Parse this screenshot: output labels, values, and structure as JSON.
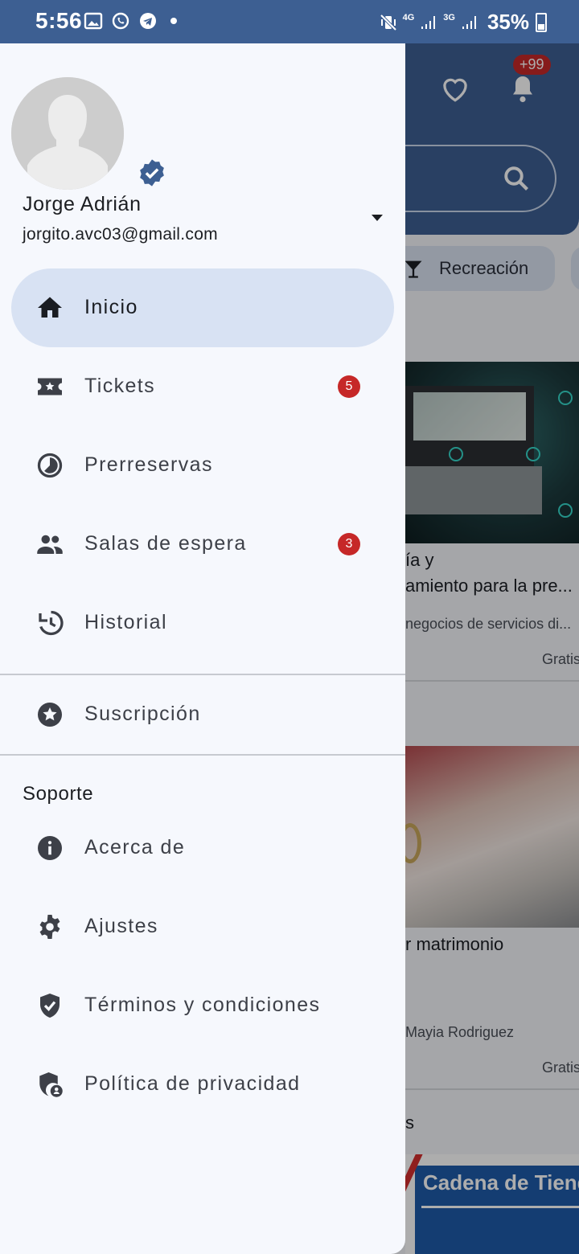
{
  "status_bar": {
    "time": "5:56",
    "net1": "4G",
    "net2": "3G",
    "battery": "35%"
  },
  "background": {
    "notifications_badge": "+99",
    "chip_label": "Recreación",
    "card1_title_line1": "ía y",
    "card1_title_line2": "amiento para la pre...",
    "card1_sub": "negocios de servicios di...",
    "card1_price": "Gratis",
    "card2_title": "r matrimonio",
    "card2_sub": "Mayia Rodriguez",
    "card2_price": "Gratis",
    "card3_header": "s",
    "card3_banner": "Cadena de Tiendas"
  },
  "drawer": {
    "user": {
      "name": "Jorge Adrián",
      "email": "jorgito.avc03@gmail.com"
    },
    "main_items": [
      {
        "label": "Inicio",
        "icon": "home-icon",
        "active": true
      },
      {
        "label": "Tickets",
        "icon": "ticket-icon",
        "badge": "5"
      },
      {
        "label": "Prerreservas",
        "icon": "pie-clock-icon"
      },
      {
        "label": "Salas de espera",
        "icon": "people-icon",
        "badge": "3"
      },
      {
        "label": "Historial",
        "icon": "history-icon"
      }
    ],
    "subscription": {
      "label": "Suscripción",
      "icon": "star-circle-icon"
    },
    "support": {
      "header": "Soporte",
      "items": [
        {
          "label": "Acerca de",
          "icon": "info-icon"
        },
        {
          "label": "Ajustes",
          "icon": "gear-icon"
        },
        {
          "label": "Términos y condiciones",
          "icon": "shield-check-icon"
        },
        {
          "label": "Política de privacidad",
          "icon": "shield-user-icon"
        }
      ]
    }
  },
  "colors": {
    "primary": "#3d5f92",
    "active_bg": "#d8e2f3",
    "badge": "#c62828",
    "drawer_bg": "#f6f8fd",
    "icon": "#3d4048"
  }
}
